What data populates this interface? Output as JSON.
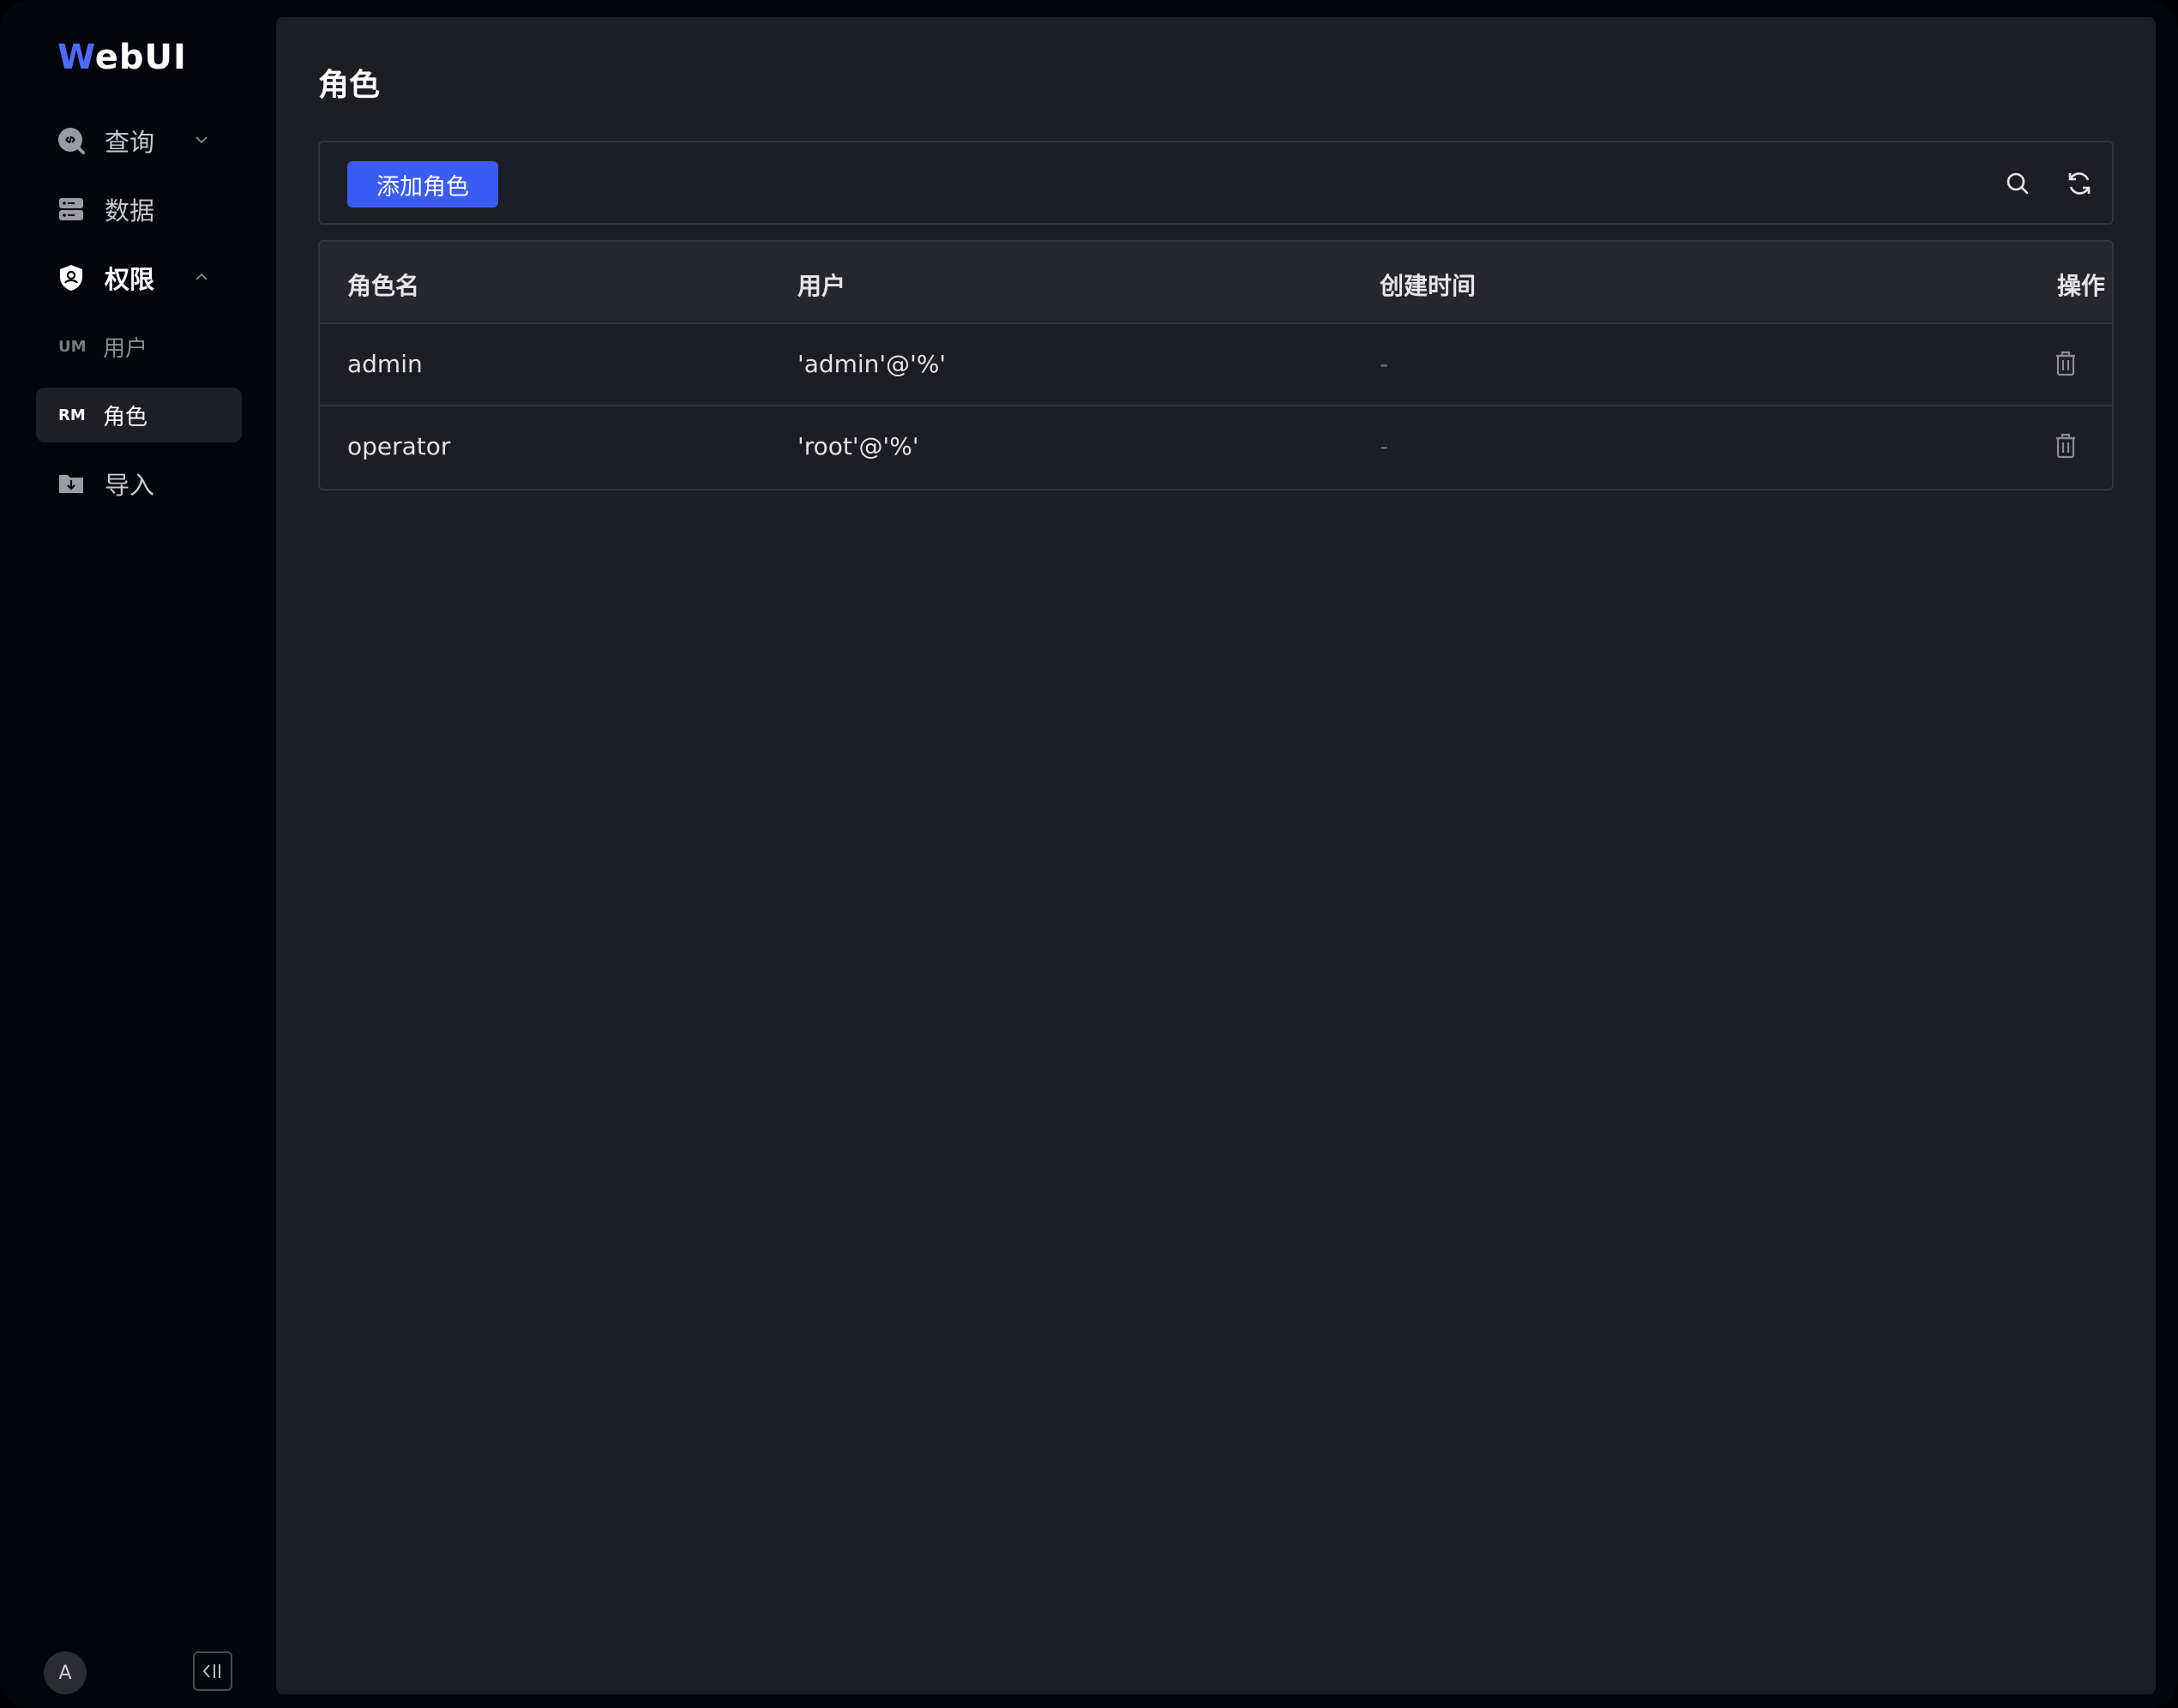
{
  "app": {
    "logo_first": "W",
    "logo_rest": "ebUI"
  },
  "sidebar": {
    "items": [
      {
        "label": "查询",
        "icon": "query-code-icon",
        "expandable": true,
        "expanded": false
      },
      {
        "label": "数据",
        "icon": "database-icon"
      },
      {
        "label": "权限",
        "icon": "shield-user-icon",
        "expandable": true,
        "expanded": true
      },
      {
        "label": "用户",
        "abbr": "UM"
      },
      {
        "label": "角色",
        "abbr": "RM",
        "active": true
      },
      {
        "label": "导入",
        "icon": "folder-import-icon"
      }
    ],
    "avatar_initial": "A"
  },
  "page": {
    "title": "角色"
  },
  "toolbar": {
    "add_label": "添加角色"
  },
  "table": {
    "columns": [
      "角色名",
      "用户",
      "创建时间",
      "操作"
    ],
    "rows": [
      {
        "role": "admin",
        "user": "'admin'@'%'",
        "created": "-"
      },
      {
        "role": "operator",
        "user": "'root'@'%'",
        "created": "-"
      }
    ]
  },
  "colors": {
    "accent": "#3a5cf5",
    "background": "#1d1e23",
    "sidebar": "#03040c"
  }
}
